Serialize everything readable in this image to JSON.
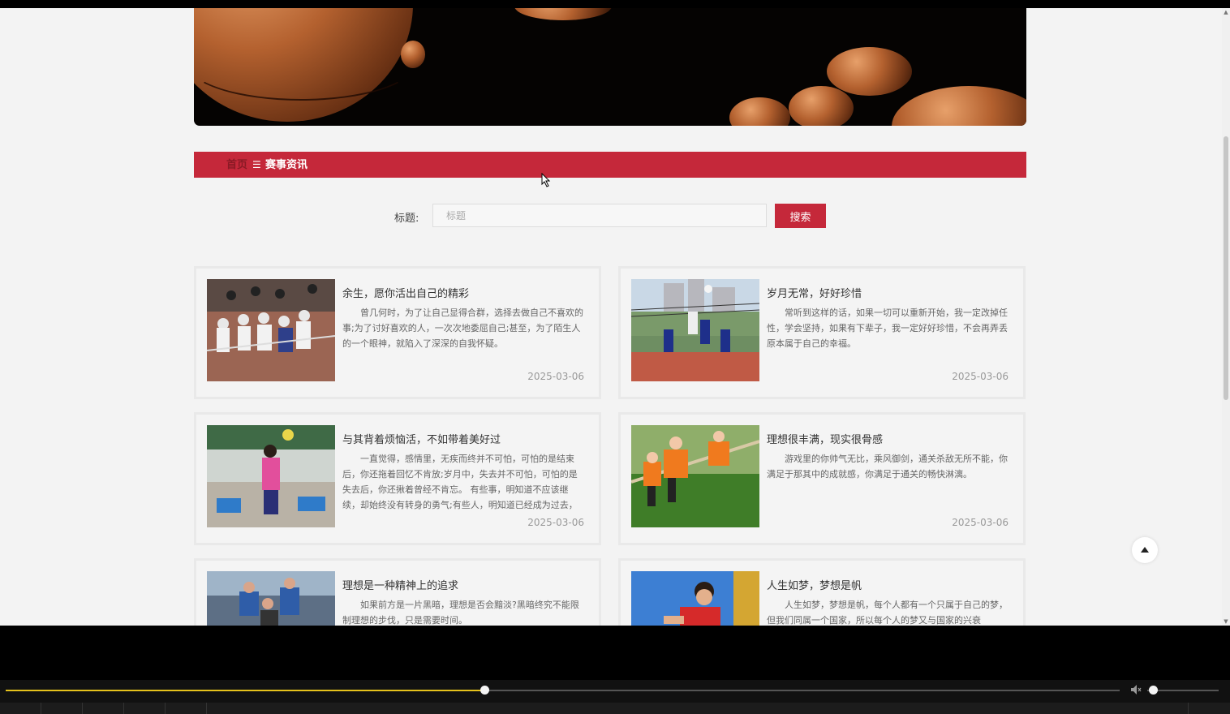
{
  "breadcrumb": {
    "home": "首页",
    "separator": "☰",
    "current": "赛事资讯"
  },
  "search": {
    "label": "标题:",
    "placeholder": "标题",
    "value": "",
    "button": "搜索"
  },
  "articles": [
    {
      "title": "余生，愿你活出自己的精彩",
      "summary": "曾几何时，为了让自己显得合群，选择去做自己不喜欢的事;为了讨好喜欢的人，一次次地委屈自己;甚至，为了陌生人的一个眼神，就陷入了深深的自我怀疑。",
      "date": "2025-03-06"
    },
    {
      "title": "岁月无常，好好珍惜",
      "summary": "常听到这样的话，如果一切可以重新开始，我一定改掉任性，学会坚持，如果有下辈子，我一定好好珍惜，不会再弄丢原本属于自己的幸福。",
      "date": "2025-03-06"
    },
    {
      "title": "与其背着烦恼活，不如带着美好过",
      "summary": "一直觉得，感情里，无疾而终并不可怕，可怕的是结束后，你还拖着回忆不肯放;岁月中，失去并不可怕，可怕的是失去后，你还揪着曾经不肯忘。 有些事，明知道不应该继续，却始终没有转身的勇气;有些人，明知道已经成为过去，",
      "date": "2025-03-06"
    },
    {
      "title": "理想很丰满，现实很骨感",
      "summary": "游戏里的你帅气无比，乘风御剑，通关杀敌无所不能，你满足于那其中的成就感，你满足于通关的畅快淋漓。",
      "date": "2025-03-06"
    },
    {
      "title": "理想是一种精神上的追求",
      "summary": "如果前方是一片黑暗，理想是否会黯淡?黑暗终究不能限制理想的步伐，只是需要时间。",
      "date": ""
    },
    {
      "title": "人生如梦，梦想是帆",
      "summary": "人生如梦，梦想是帆，每个人都有一个只属于自己的梦，但我们同属一个国家，所以每个人的梦又与国家的兴衰",
      "date": ""
    }
  ],
  "player": {
    "progress_fraction": 0.43,
    "volume_fraction": 0.08
  },
  "colors": {
    "accent": "#c5283a",
    "progress": "#e5c21c"
  }
}
